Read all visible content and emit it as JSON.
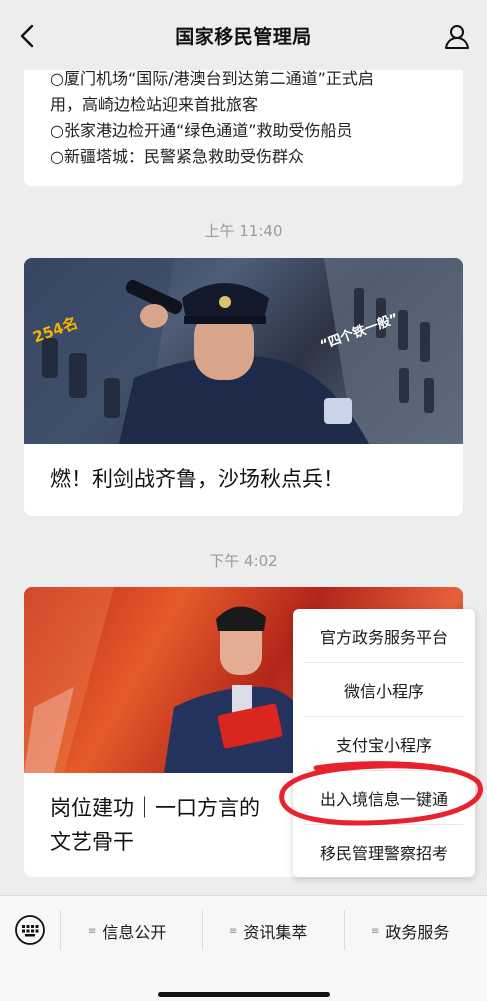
{
  "header": {
    "title": "国家移民管理局"
  },
  "card1": {
    "lines": [
      "○厦门机场“国际/港澳台到达第二通道”正式启",
      "用，高崎边检站迎来首批旅客",
      "○张家港边检开通“绿色通道”救助受伤船员",
      "○新疆塔城：民警紧急救助受伤群众"
    ]
  },
  "time1": "上午 11:40",
  "card2": {
    "title": "燃！利剑战齐鲁，沙场秋点兵！",
    "badge": "254名",
    "banner_text": "“四个铁一般”"
  },
  "time2": "下午 4:02",
  "card3": {
    "title_line1": "岗位建功｜一口方言的",
    "title_line2": "文艺骨干"
  },
  "popup": {
    "items": [
      "官方政务服务平台",
      "微信小程序",
      "支付宝小程序",
      "出入境信息一键通",
      "移民管理警察招考"
    ]
  },
  "tabs": [
    "信息公开",
    "资讯集萃",
    "政务服务"
  ],
  "colors": {
    "annotation": "#e8222c",
    "background": "#ededed"
  }
}
